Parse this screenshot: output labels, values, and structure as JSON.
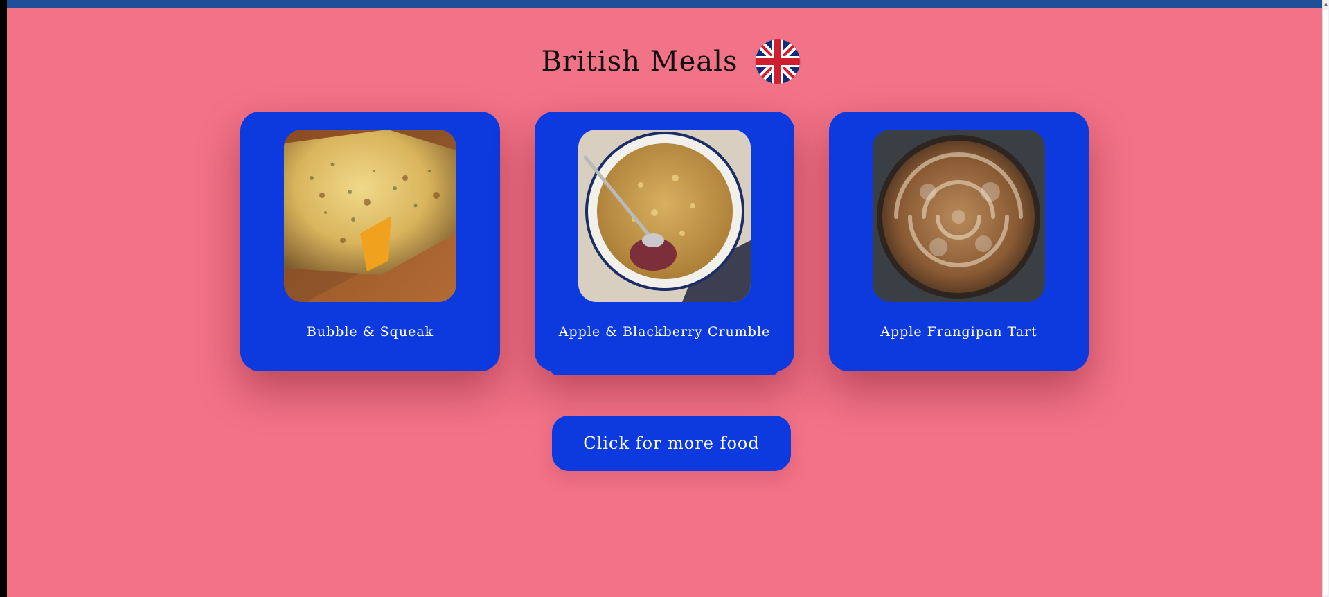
{
  "page": {
    "title": "British Meals",
    "flag_icon": "union-jack-flag-icon"
  },
  "cards": [
    {
      "label": "Bubble & Squeak",
      "image_icon": "bubble-and-squeak-photo"
    },
    {
      "label": "Apple & Blackberry Crumble",
      "image_icon": "apple-blackberry-crumble-photo"
    },
    {
      "label": "Apple Frangipan Tart",
      "image_icon": "apple-frangipan-tart-photo"
    }
  ],
  "button": {
    "label": "Click for more food"
  },
  "colors": {
    "background": "#f27287",
    "card": "#0d3ade",
    "top_bar": "#1f4f99"
  }
}
